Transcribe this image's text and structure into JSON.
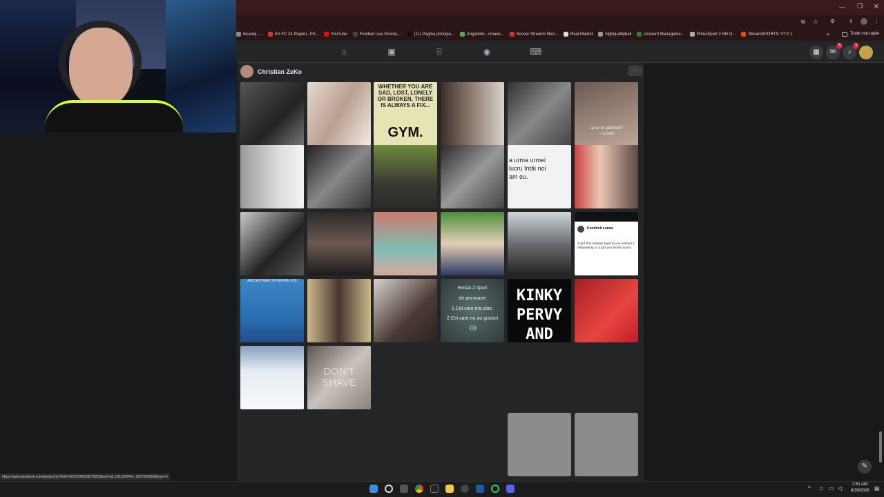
{
  "bookmarks": [
    {
      "label": "lesane] -...",
      "color": "#888"
    },
    {
      "label": "EA FC 24 Players, Pri...",
      "color": "#d03a2b"
    },
    {
      "label": "YouTube",
      "color": "#ff0000"
    },
    {
      "label": "Football Live Scores,...",
      "color": "#444"
    },
    {
      "label": "(11) Pagina principa...",
      "color": "#111"
    },
    {
      "label": "Angebote - smava...",
      "color": "#4caf50"
    },
    {
      "label": "Soccer Streams Red...",
      "color": "#c0392b"
    },
    {
      "label": "Real Madrid",
      "color": "#e0e0e0"
    },
    {
      "label": "highqualityball",
      "color": "#999"
    },
    {
      "label": "Account Manageme...",
      "color": "#2e7d32"
    },
    {
      "label": "PrimaSport 2 HD O...",
      "color": "#aaa"
    },
    {
      "label": "StreamSPORTS: VTV 1",
      "color": "#e65100"
    }
  ],
  "bookmarks_overflow": "»",
  "bookmarks_folder": "Toate marcajele",
  "profile": {
    "name": "Christian ZeKo",
    "more": "···"
  },
  "notifications": {
    "messenger_count": "5",
    "bell_count": "3"
  },
  "tiles_text": {
    "gym": "WHETHER YOU ARE SAD, LOST, LONELY OR BROKEN, THERE IS ALWAYS A FIX...",
    "gym_big": "GYM.",
    "bed_caption_1": "La ce te gândești?",
    "bed_caption_2": "- La bani",
    "meme": "a urma urmei lucru întâi noi am eu.",
    "tweet_name": "Kendrick Lamar",
    "tweet_text": "A girl that remains loyal to you without a relationship, is a girl you should marry.",
    "exista_1": "Exista 2 tipuri",
    "exista_2": "de persoane",
    "exista_3": "1.Cei care ma plac.",
    "exista_4": "2.Cei care nu au gusturi",
    "exista_5": ":))))",
    "kinky_1": "KINKY",
    "kinky_2": "PERVY",
    "kinky_3": "AND",
    "cam_caption": "AM CASTIGAT SI PENTRU VOI",
    "dont_shave": "DON'T SHAVE"
  },
  "status_url": "https://www.facebook.com/photo.php?fbid=10202348518579263&set=pb.1381220442.-2207520000&type=3",
  "clock": {
    "time": "2:51 AM",
    "date": "8/30/2026"
  }
}
